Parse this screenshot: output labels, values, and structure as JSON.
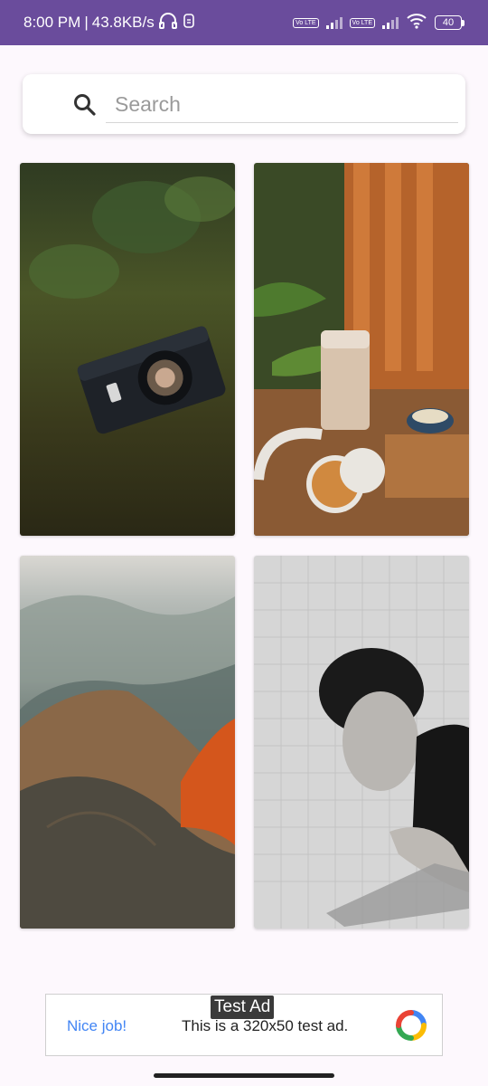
{
  "status_bar": {
    "time": "8:00 PM",
    "separator": "|",
    "net_speed": "43.8KB/s",
    "volte_label": "Vo LTE",
    "battery_level": "40",
    "icons": [
      "headphones-icon",
      "sim-icon",
      "volte-icon",
      "signal-icon",
      "wifi-icon",
      "battery-icon"
    ]
  },
  "search": {
    "placeholder": "Search",
    "value": ""
  },
  "gallery": {
    "items": [
      {
        "subject": "camera-on-moss-photo"
      },
      {
        "subject": "coffee-headphones-table-photo"
      },
      {
        "subject": "mountain-hiker-photo"
      },
      {
        "subject": "man-portrait-bw-photo"
      }
    ]
  },
  "ad": {
    "badge": "Test Ad",
    "left_label": "Nice job!",
    "text": "This is a 320x50 test ad.",
    "logo": "ad-logo-icon"
  }
}
